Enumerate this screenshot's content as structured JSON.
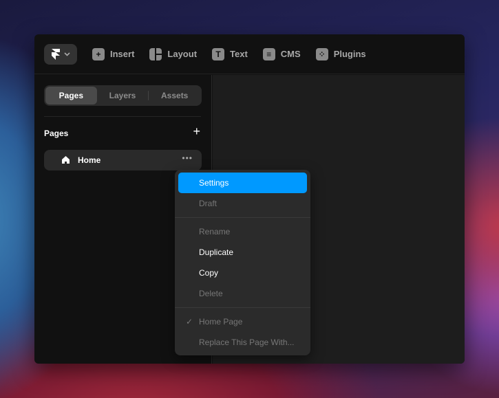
{
  "toolbar": {
    "items": [
      {
        "label": "Insert",
        "icon": "plus-icon"
      },
      {
        "label": "Layout",
        "icon": "layout-icon"
      },
      {
        "label": "Text",
        "icon": "text-icon"
      },
      {
        "label": "CMS",
        "icon": "database-icon"
      },
      {
        "label": "Plugins",
        "icon": "plugins-icon"
      }
    ]
  },
  "sidebar": {
    "tabs": [
      "Pages",
      "Layers",
      "Assets"
    ],
    "active_tab": "Pages",
    "section_title": "Pages",
    "pages": [
      {
        "label": "Home",
        "icon": "home-icon"
      }
    ]
  },
  "context_menu": {
    "items": [
      {
        "label": "Settings",
        "state": "highlighted"
      },
      {
        "label": "Draft",
        "state": "disabled"
      },
      {
        "label": "Rename",
        "state": "disabled"
      },
      {
        "label": "Duplicate",
        "state": "enabled"
      },
      {
        "label": "Copy",
        "state": "enabled"
      },
      {
        "label": "Delete",
        "state": "disabled"
      },
      {
        "label": "Home Page",
        "state": "disabled",
        "checked": true
      },
      {
        "label": "Replace This Page With...",
        "state": "disabled"
      }
    ]
  },
  "colors": {
    "accent": "#0099ff"
  }
}
